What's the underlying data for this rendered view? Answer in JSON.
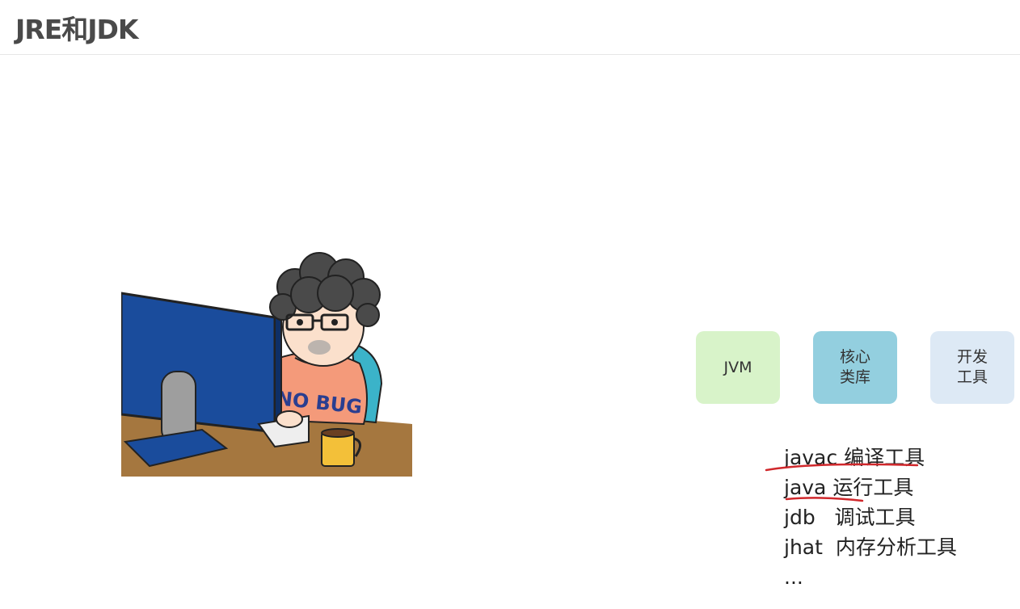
{
  "page": {
    "title": "JRE和JDK"
  },
  "illustration": {
    "shirt_text": "NO BUG",
    "icon": "programmer-at-computer"
  },
  "components": [
    {
      "label": "JVM",
      "color": "#d8f3c9"
    },
    {
      "label": "核心\n类库",
      "color": "#93cfdf"
    },
    {
      "label": "开发\n工具",
      "color": "#dde9f5"
    }
  ],
  "tools": [
    {
      "cmd": "javac",
      "desc": "编译工具"
    },
    {
      "cmd": "java",
      "desc": "运行工具"
    },
    {
      "cmd": "jdb",
      "desc": "调试工具"
    },
    {
      "cmd": "jhat",
      "desc": "内存分析工具"
    },
    {
      "cmd": "...",
      "desc": ""
    }
  ],
  "colors": {
    "annotation": "#d0282c"
  }
}
